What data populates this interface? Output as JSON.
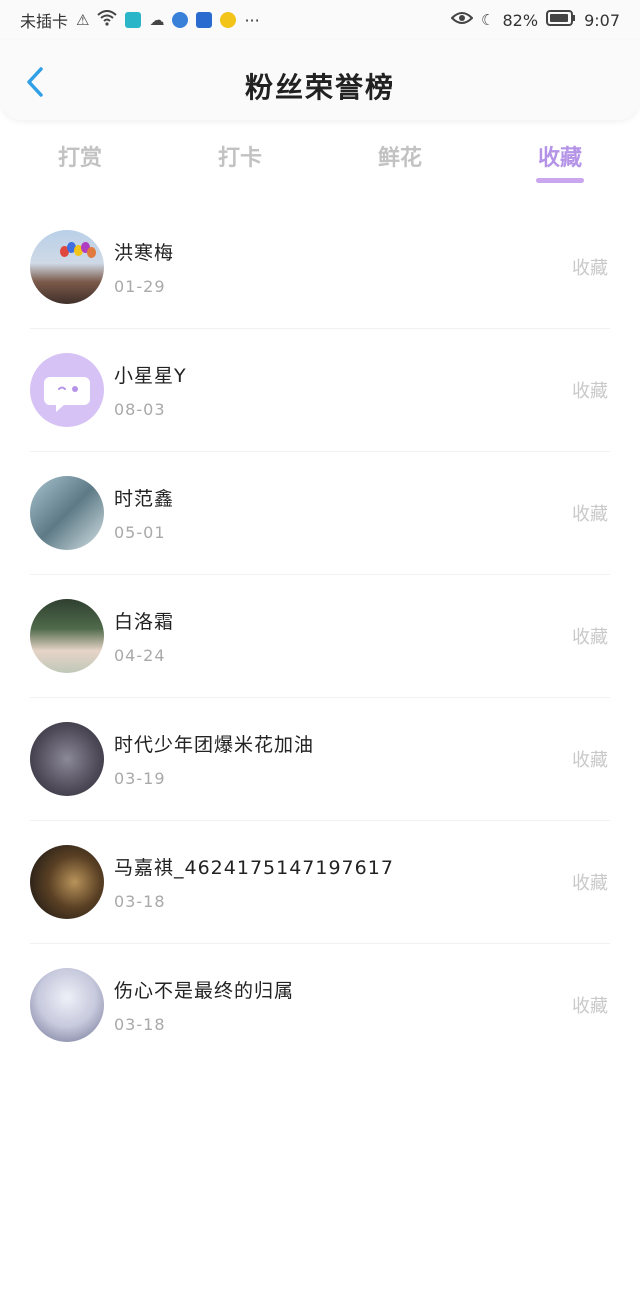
{
  "status_bar": {
    "carrier": "未插卡",
    "more": "···",
    "battery": "82%",
    "time": "9:07"
  },
  "header": {
    "title": "粉丝荣誉榜"
  },
  "tabs": [
    {
      "label": "打赏"
    },
    {
      "label": "打卡"
    },
    {
      "label": "鲜花"
    },
    {
      "label": "收藏"
    }
  ],
  "active_tab": "收藏",
  "list": [
    {
      "name": "洪寒梅",
      "date": "01-29",
      "action": "收藏"
    },
    {
      "name": "小星星Y",
      "date": "08-03",
      "action": "收藏"
    },
    {
      "name": "时范鑫",
      "date": "05-01",
      "action": "收藏"
    },
    {
      "name": "白洛霜",
      "date": "04-24",
      "action": "收藏"
    },
    {
      "name": "时代少年团爆米花加油",
      "date": "03-19",
      "action": "收藏"
    },
    {
      "name": "马嘉祺_4624175147197617",
      "date": "03-18",
      "action": "收藏"
    },
    {
      "name": "伤心不是最终的归属",
      "date": "03-18",
      "action": "收藏"
    }
  ],
  "colors": {
    "accent": "#b594e8",
    "back_arrow": "#2f9fe6",
    "inactive_tab": "#c2c2c2",
    "action_text": "#c9c9c9"
  }
}
